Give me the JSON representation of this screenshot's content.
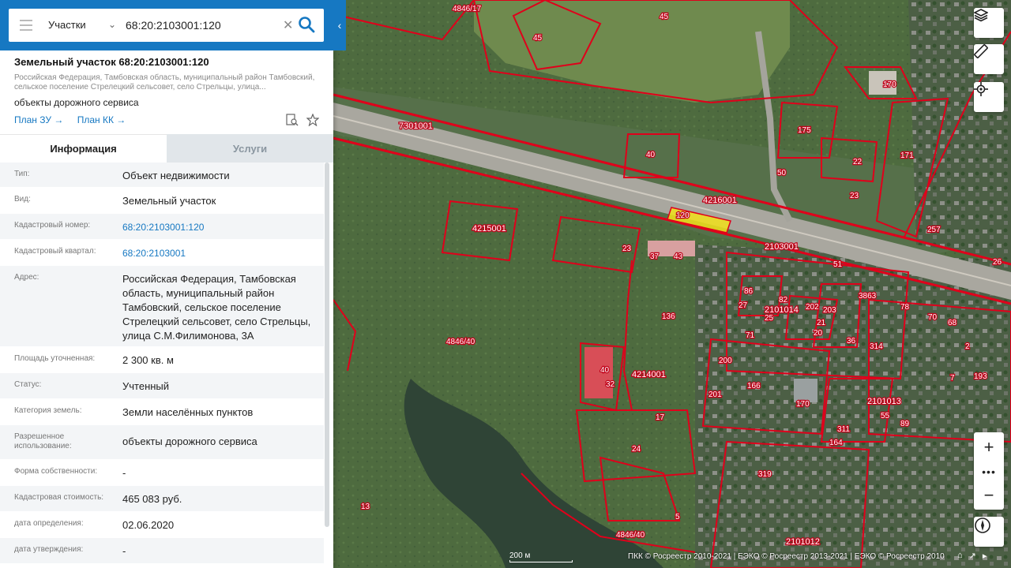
{
  "search": {
    "type_label": "Участки",
    "value": "68:20:2103001:120"
  },
  "object": {
    "title": "Земельный участок 68:20:2103001:120",
    "address_short": "Российская Федерация, Тамбовская область, муниципальный район Тамбовский, сельское поселение Стрелецкий сельсовет, село Стрельцы, улица...",
    "use": "объекты дорожного сервиса",
    "plan_zu": "План ЗУ →",
    "plan_kk": "План КК →"
  },
  "tabs": {
    "info": "Информация",
    "services": "Услуги"
  },
  "info": {
    "type_k": "Тип:",
    "type_v": "Объект недвижимости",
    "kind_k": "Вид:",
    "kind_v": "Земельный участок",
    "cad_num_k": "Кадастровый номер:",
    "cad_num_v": "68:20:2103001:120",
    "cad_q_k": "Кадастровый квартал:",
    "cad_q_v": "68:20:2103001",
    "addr_k": "Адрес:",
    "addr_v": "Российская Федерация, Тамбовская область, муниципальный район Тамбовский, сельское поселение Стрелецкий сельсовет, село Стрельцы, улица С.М.Филимонова, 3А",
    "area_k": "Площадь уточненная:",
    "area_v": "2 300 кв. м",
    "status_k": "Статус:",
    "status_v": "Учтенный",
    "cat_k": "Категория земель:",
    "cat_v": "Земли населённых пунктов",
    "perm_k": "Разрешенное использование:",
    "perm_v": "объекты дорожного сервиса",
    "own_k": "Форма собственности:",
    "own_v": "-",
    "cost_k": "Кадастровая стоимость:",
    "cost_v": "465 083 руб.",
    "det_k": "дата определения:",
    "det_v": "02.06.2020",
    "appr_k": "дата утверждения:",
    "appr_v": "-"
  },
  "map": {
    "attribution": "ПКК © Росреестр 2010-2021 | ЕЭКО © Росреестр 2013-2021 | ЕЭКО © Росреестр 2010",
    "scale": "200 м",
    "quarters": [
      "7301001",
      "4216001",
      "2103001",
      "4215001",
      "4214001",
      "2101014",
      "2101013",
      "2101012"
    ],
    "parcels": [
      "4846/17",
      "45",
      "45",
      "170",
      "175",
      "171",
      "22",
      "23",
      "40",
      "50",
      "120",
      "257",
      "23",
      "37",
      "43",
      "136",
      "86",
      "27",
      "25",
      "71",
      "82",
      "202",
      "203",
      "21",
      "20",
      "36",
      "314",
      "78",
      "70",
      "68",
      "2",
      "7",
      "193",
      "4846/40",
      "40",
      "32",
      "200",
      "201",
      "166",
      "170",
      "311",
      "164",
      "55",
      "89",
      "17",
      "24",
      "4846/40",
      "5",
      "13",
      "319",
      "3863",
      "51",
      "26"
    ]
  },
  "colors": {
    "accent": "#1678c2",
    "parcel": "#e0001b",
    "selected": "#f2e21a"
  },
  "icons": [
    "menu-icon",
    "chevron-down-icon",
    "clear-icon",
    "search-icon",
    "layers-icon",
    "ruler-icon",
    "locate-icon",
    "zoom-in-icon",
    "more-icon",
    "zoom-out-icon",
    "compass-icon",
    "document-search-icon",
    "star-icon"
  ]
}
